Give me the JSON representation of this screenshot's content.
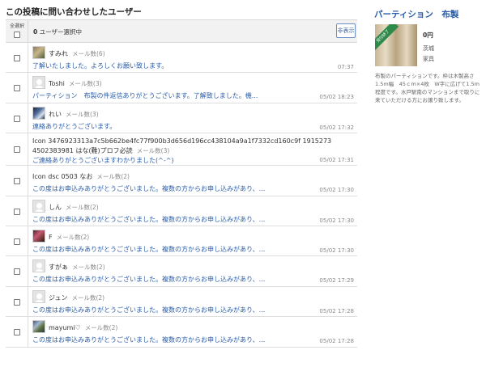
{
  "page": {
    "title": "この投稿に問い合わせしたユーザー"
  },
  "list_header": {
    "select_all_label": "全選択",
    "selected_count": "0",
    "selected_suffix": " ユーザー選択中",
    "hide_button": "非表示"
  },
  "rows": [
    {
      "name": "すみれ",
      "mail_count": "メール数(6)",
      "message": "了解いたしました。よろしくお願い致します。",
      "time": "07:37",
      "avatar": "photo-a"
    },
    {
      "name": "Toshi",
      "mail_count": "メール数(3)",
      "message": "パーティション　布製の件返信ありがとうございます。了解致しました。機...",
      "time": "05/02 18:23",
      "avatar": "plain"
    },
    {
      "name": "れい",
      "mail_count": "メール数(3)",
      "message": "連絡ありがとうございます。",
      "time": "05/02 17:32",
      "avatar": "photo-b"
    },
    {
      "name": "Icon 3476923313a7c5b662be4fc77f900b3d656d196cc438104a9a1f7332cd160c9f 1915273 4502383981 はな(難)プロフ必読",
      "mail_count": "メール数(3)",
      "message": "ご連絡ありがとうございますわかりました(^-^)",
      "time": "05/02 17:31",
      "avatar": "none"
    },
    {
      "name": "Icon dsc 0503 なお",
      "mail_count": "メール数(2)",
      "message": "この度はお申込みありがとうございました。複数の方からお申し込みがあり、...",
      "time": "05/02 17:30",
      "avatar": "none"
    },
    {
      "name": "しん",
      "mail_count": "メール数(2)",
      "message": "この度はお申込みありがとうございました。複数の方からお申し込みがあり、...",
      "time": "05/02 17:30",
      "avatar": "plain"
    },
    {
      "name": "F",
      "mail_count": "メール数(2)",
      "message": "この度はお申込みありがとうございました。複数の方からお申し込みがあり、...",
      "time": "05/02 17:30",
      "avatar": "photo-c"
    },
    {
      "name": "すがぁ",
      "mail_count": "メール数(2)",
      "message": "この度はお申込みありがとうございました。複数の方からお申し込みがあり、...",
      "time": "05/02 17:29",
      "avatar": "plain"
    },
    {
      "name": "ジュン",
      "mail_count": "メール数(2)",
      "message": "この度はお申込みありがとうございました。複数の方からお申し込みがあり、...",
      "time": "05/02 17:28",
      "avatar": "plain"
    },
    {
      "name": "mayumi♡",
      "mail_count": "メール数(2)",
      "message": "この度はお申込みありがとうございました。複数の方からお申し込みがあり、...",
      "time": "05/02 17:28",
      "avatar": "photo-d"
    }
  ],
  "item": {
    "title": "パーティション　布製",
    "badge": "受付終了",
    "price": "0円",
    "prefecture": "茨城",
    "category": "家具",
    "description": "布製のパーティションです。枠は木製高さ　1.5m幅　45ｃm×4枚　W字に広げて1.5m程度です。水戸駅南のマンションまで取りに来ていただける方にお譲り致します。"
  },
  "colors": {
    "link": "#2a5ca8",
    "badge": "#2e8a4a"
  }
}
